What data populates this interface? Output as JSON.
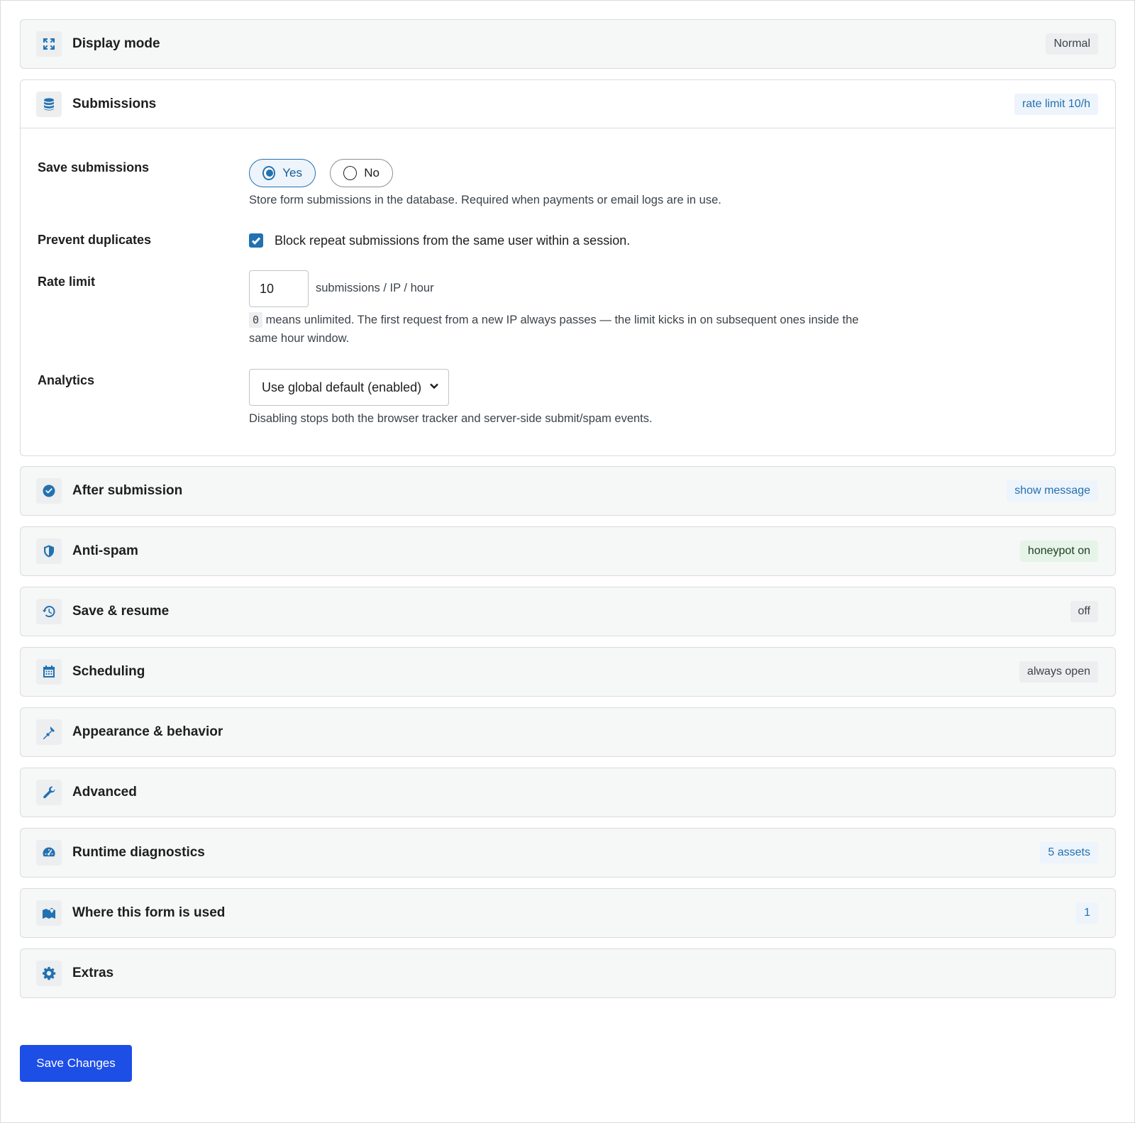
{
  "sections": {
    "display_mode": {
      "title": "Display mode",
      "badge": "Normal",
      "icon": "expand-icon"
    },
    "submissions": {
      "title": "Submissions",
      "badge": "rate limit 10/h",
      "icon": "database-icon"
    },
    "after_submission": {
      "title": "After submission",
      "badge": "show message",
      "icon": "check-circle-icon"
    },
    "anti_spam": {
      "title": "Anti-spam",
      "badge": "honeypot on",
      "icon": "shield-icon"
    },
    "save_resume": {
      "title": "Save & resume",
      "badge": "off",
      "icon": "history-icon"
    },
    "scheduling": {
      "title": "Scheduling",
      "badge": "always open",
      "icon": "calendar-icon"
    },
    "appearance": {
      "title": "Appearance & behavior",
      "icon": "brush-icon"
    },
    "advanced": {
      "title": "Advanced",
      "icon": "wrench-icon"
    },
    "diagnostics": {
      "title": "Runtime diagnostics",
      "badge": "5 assets",
      "icon": "gauge-icon"
    },
    "usage": {
      "title": "Where this form is used",
      "badge": "1",
      "icon": "map-icon"
    },
    "extras": {
      "title": "Extras",
      "icon": "gear-icon"
    }
  },
  "submissions_form": {
    "save_label": "Save submissions",
    "yes": "Yes",
    "no": "No",
    "save_help": "Store form submissions in the database. Required when payments or email logs are in use.",
    "duplicates_label": "Prevent duplicates",
    "duplicates_text": "Block repeat submissions from the same user within a session.",
    "rate_label": "Rate limit",
    "rate_value": "10",
    "rate_unit": "submissions / IP / hour",
    "rate_help_code": "0",
    "rate_help_line1": "means unlimited. The first request from a new IP always passes — the limit kicks in on subsequent ones inside the",
    "rate_help_line2": "same hour window.",
    "analytics_label": "Analytics",
    "analytics_value": "Use global default (enabled)",
    "analytics_help": "Disabling stops both the browser tracker and server-side submit/spam events."
  },
  "save_button": "Save Changes",
  "colors": {
    "accent": "#2271b1",
    "primary_button": "#1d4ee6",
    "green_badge": "#e6f4e8"
  }
}
